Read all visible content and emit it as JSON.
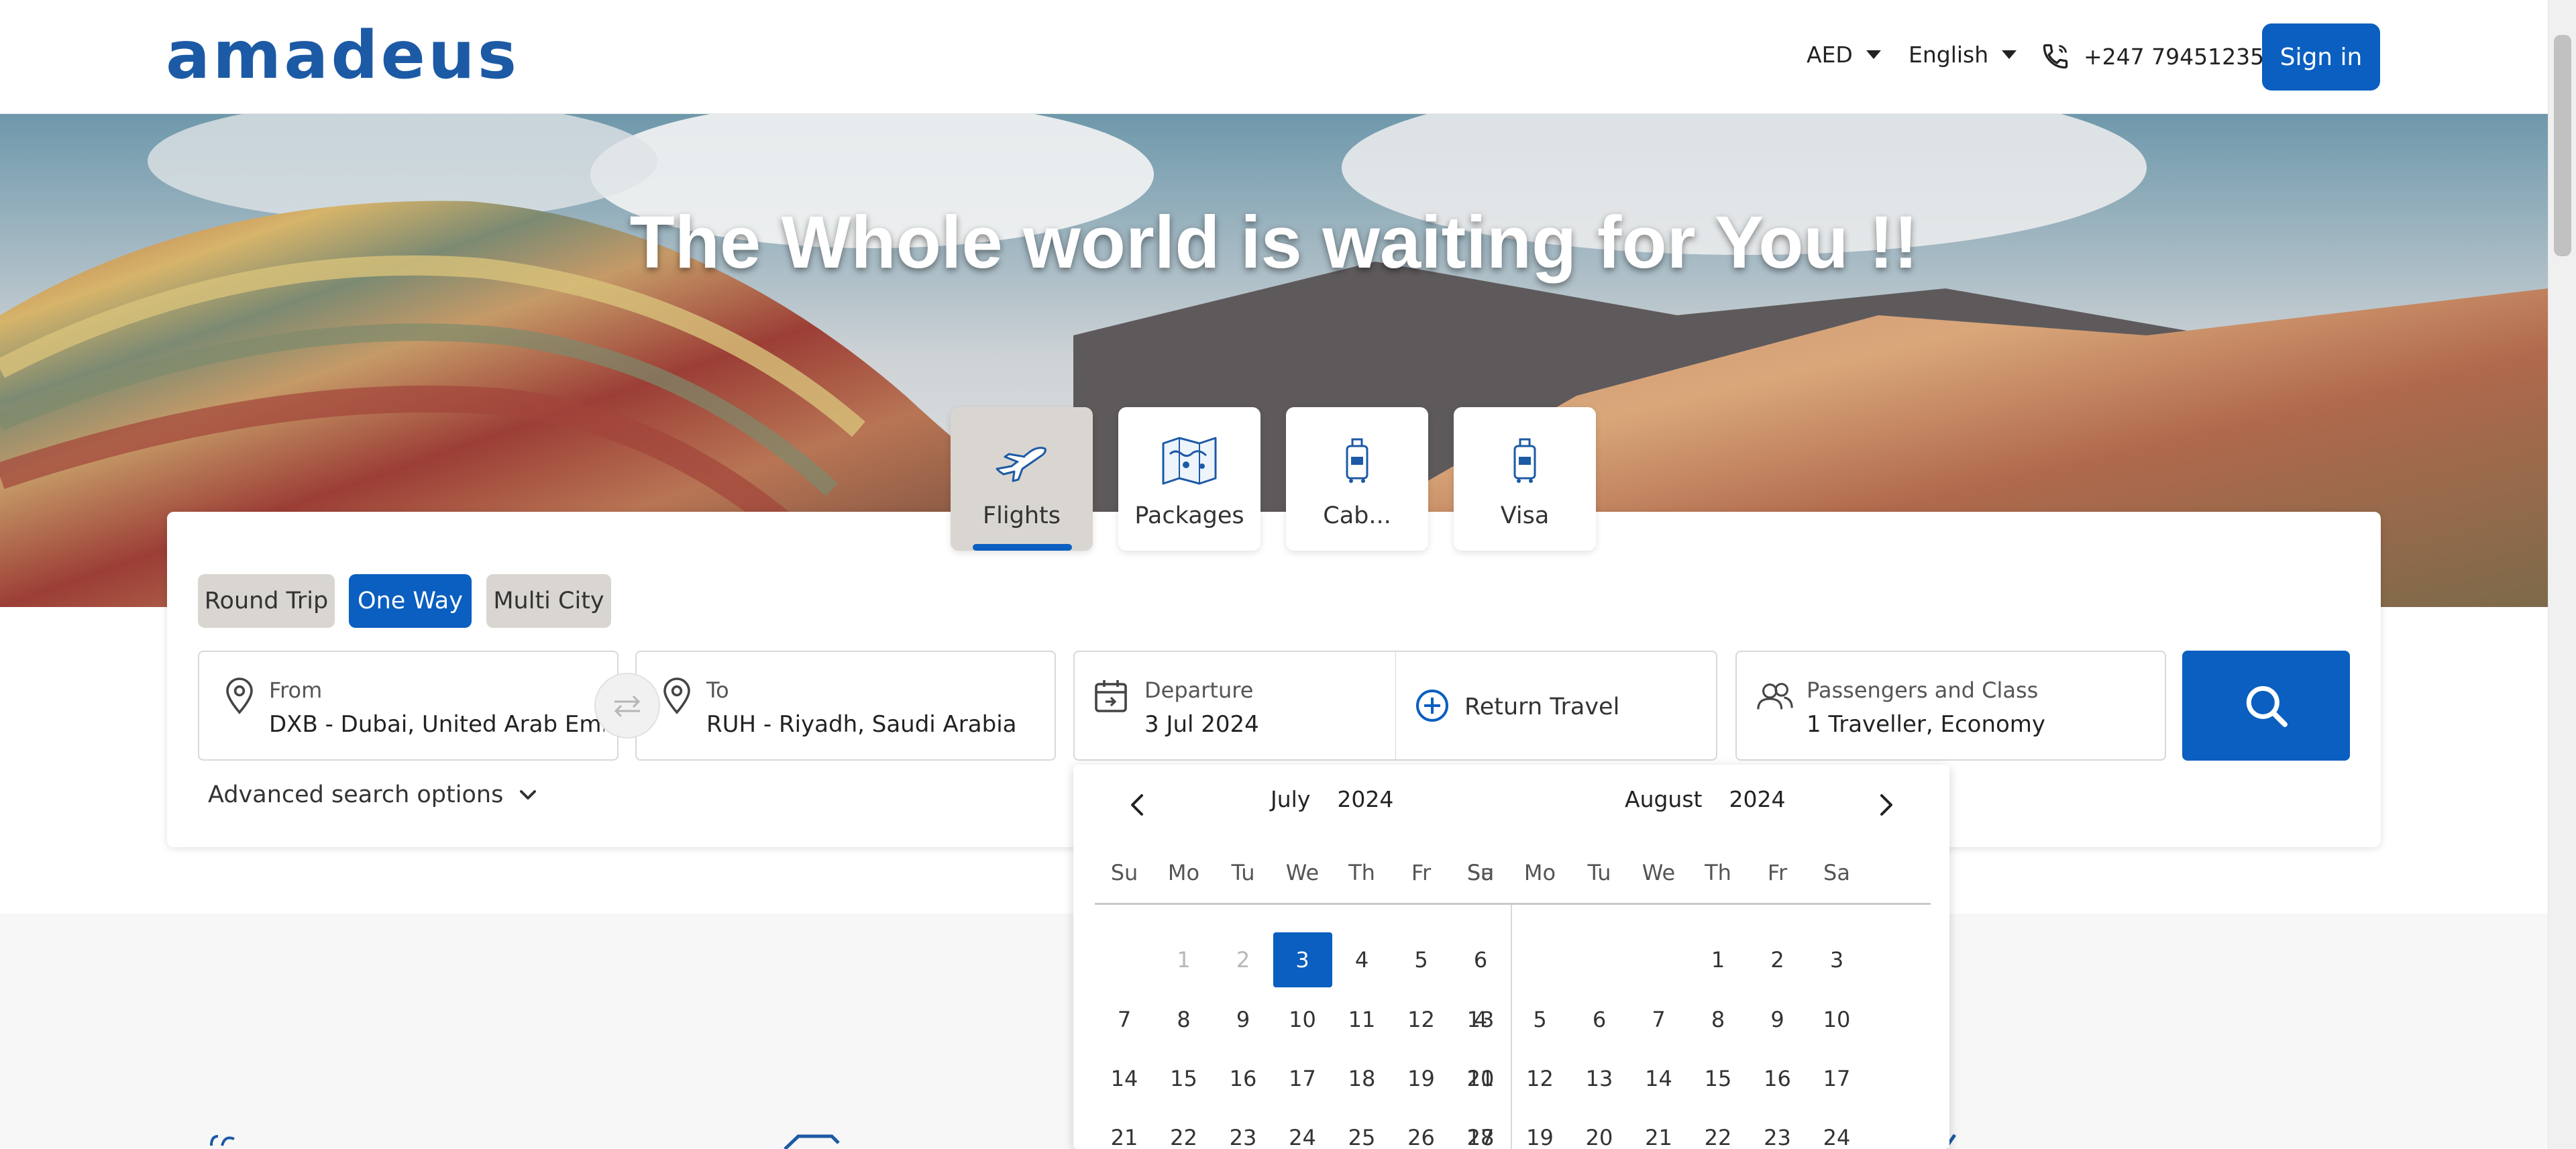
{
  "header": {
    "logo_text": "amadeus",
    "currency": "AED",
    "language": "English",
    "phone": "+247 79451235",
    "signin_label": "Sign in"
  },
  "hero": {
    "title": "The Whole world is waiting for You !!"
  },
  "services": [
    {
      "label": "Flights",
      "icon": "airplane-icon",
      "active": true
    },
    {
      "label": "Packages",
      "icon": "map-icon",
      "active": false
    },
    {
      "label": "Cab...",
      "icon": "luggage-icon",
      "active": false
    },
    {
      "label": "Visa",
      "icon": "luggage-icon",
      "active": false
    }
  ],
  "trip_types": [
    {
      "label": "Round Trip",
      "active": false
    },
    {
      "label": "One Way",
      "active": true
    },
    {
      "label": "Multi City",
      "active": false
    }
  ],
  "search": {
    "from_label": "From",
    "from_value": "DXB - Dubai, United Arab Emira...",
    "to_label": "To",
    "to_value": "RUH - Riyadh, Saudi Arabia",
    "departure_label": "Departure",
    "departure_value": "3 Jul 2024",
    "return_label": "Return Travel",
    "passengers_label": "Passengers and Class",
    "passengers_value": "1 Traveller, Economy",
    "advanced_label": "Advanced search options"
  },
  "calendar": {
    "weekdays": [
      "Su",
      "Mo",
      "Tu",
      "We",
      "Th",
      "Fr",
      "Sa"
    ],
    "months": [
      {
        "name": "July",
        "year": "2024",
        "rows": [
          [
            "",
            "1",
            "2",
            "3",
            "4",
            "5",
            "6"
          ],
          [
            "7",
            "8",
            "9",
            "10",
            "11",
            "12",
            "13"
          ],
          [
            "14",
            "15",
            "16",
            "17",
            "18",
            "19",
            "20"
          ],
          [
            "21",
            "22",
            "23",
            "24",
            "25",
            "26",
            "27"
          ]
        ],
        "disabled": [
          "1",
          "2"
        ],
        "selected": "3"
      },
      {
        "name": "August",
        "year": "2024",
        "rows": [
          [
            "",
            "",
            "",
            "",
            "1",
            "2",
            "3"
          ],
          [
            "4",
            "5",
            "6",
            "7",
            "8",
            "9",
            "10"
          ],
          [
            "11",
            "12",
            "13",
            "14",
            "15",
            "16",
            "17"
          ],
          [
            "18",
            "19",
            "20",
            "21",
            "22",
            "23",
            "24"
          ]
        ],
        "disabled": [],
        "selected": ""
      }
    ]
  },
  "colors": {
    "brand": "#0a5fc0",
    "tab_active_bg": "#d9d5d0"
  }
}
